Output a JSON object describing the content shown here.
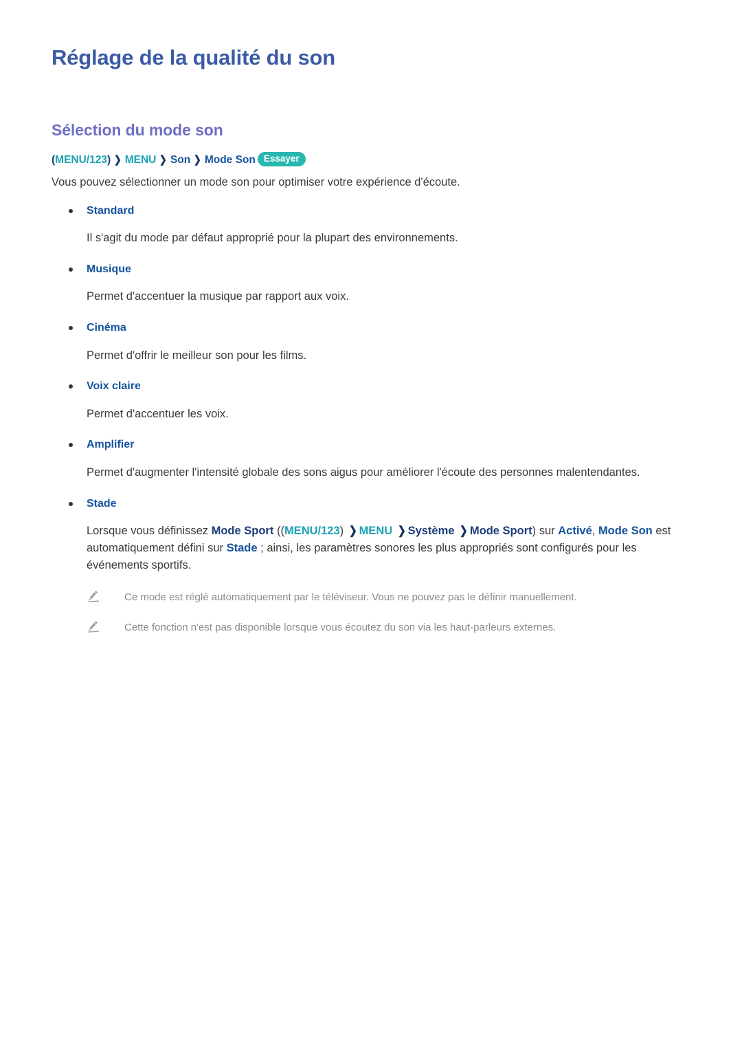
{
  "document": {
    "title": "Réglage de la qualité du son",
    "section_title": "Sélection du mode son"
  },
  "colors": {
    "title": "#3b5ba5",
    "section_title": "#6d6fc4",
    "keyword_blue": "#15539e",
    "keyword_teal": "#1ba3b5",
    "keyword_navy": "#1d3c7a",
    "badge_bg": "#27b7ae",
    "body_text": "#3a3a3a",
    "note_text": "#8a8a8a"
  },
  "breadcrumb": {
    "open_paren": "(",
    "menu123": "MENU/123",
    "close_paren": ")",
    "chevron": "❯",
    "menu": "MENU",
    "son": "Son",
    "mode_son": "Mode Son",
    "try_badge": "Essayer"
  },
  "intro": "Vous pouvez sélectionner un mode son pour optimiser votre expérience d'écoute.",
  "items": [
    {
      "label": "Standard",
      "body": "Il s'agit du mode par défaut approprié pour la plupart des environnements."
    },
    {
      "label": "Musique",
      "body": "Permet d'accentuer la musique par rapport aux voix."
    },
    {
      "label": "Cinéma",
      "body": "Permet d'offrir le meilleur son pour les films."
    },
    {
      "label": "Voix claire",
      "body": "Permet d'accentuer les voix."
    },
    {
      "label": "Amplifier",
      "body": "Permet d'augmenter l'intensité globale des sons aigus pour améliorer l'écoute des personnes malentendantes."
    },
    {
      "label": "Stade",
      "body": ""
    }
  ],
  "stade_paragraph": {
    "p1": "Lorsque vous définissez ",
    "mode_sport_1": "Mode Sport",
    "p2": " ((",
    "menu123": "MENU/123",
    "p3": ") ",
    "chevron": "❯",
    "menu": "MENU",
    "systeme": "Système",
    "mode_sport_2": "Mode Sport",
    "p4": ") sur ",
    "active": "Activé",
    "p5": ", ",
    "mode_son": "Mode Son",
    "p6": " est automatiquement défini sur ",
    "stade": "Stade",
    "p7": " ; ainsi, les paramètres sonores les plus appropriés sont configurés pour les événements sportifs."
  },
  "notes": [
    {
      "icon": "pencil-icon",
      "text": "Ce mode est réglé automatiquement par le téléviseur. Vous ne pouvez pas le définir manuellement."
    },
    {
      "icon": "pencil-icon",
      "text": "Cette fonction n'est pas disponible lorsque vous écoutez du son via les haut-parleurs externes."
    }
  ]
}
